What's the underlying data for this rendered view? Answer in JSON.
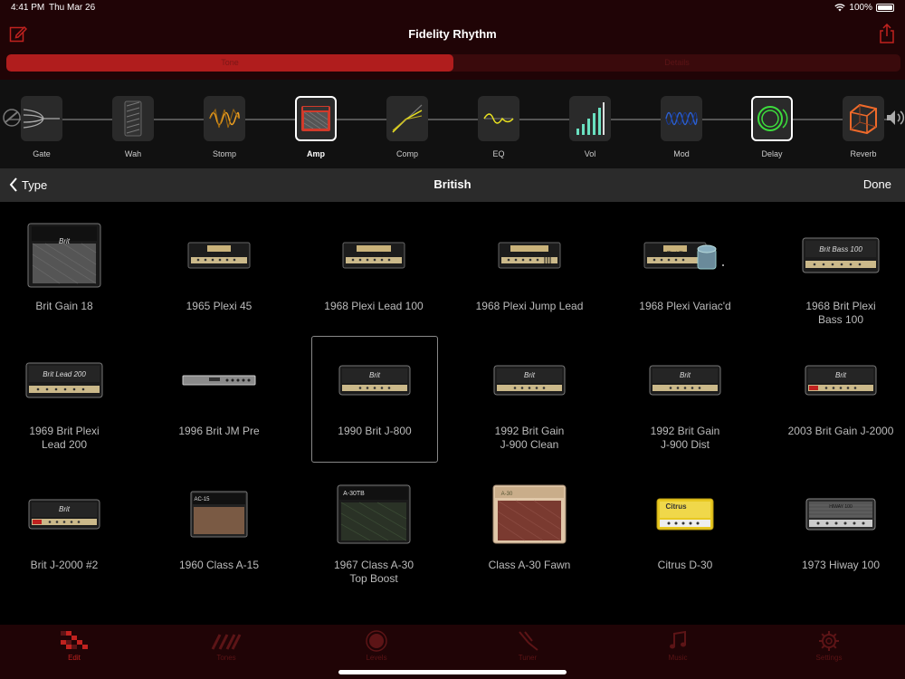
{
  "status": {
    "time": "4:41 PM",
    "date": "Thu Mar 26",
    "battery": "100%"
  },
  "header": {
    "title": "Fidelity Rhythm"
  },
  "segments": [
    {
      "label": "Tone",
      "active": true
    },
    {
      "label": "Details",
      "active": false
    }
  ],
  "chain": {
    "items": [
      {
        "label": "Gate",
        "icon": "gate-icon"
      },
      {
        "label": "Wah",
        "icon": "wah-icon"
      },
      {
        "label": "Stomp",
        "icon": "stomp-icon"
      },
      {
        "label": "Amp",
        "icon": "amp-icon",
        "selected": true
      },
      {
        "label": "Comp",
        "icon": "comp-icon"
      },
      {
        "label": "EQ",
        "icon": "eq-icon"
      },
      {
        "label": "Vol",
        "icon": "vol-icon"
      },
      {
        "label": "Mod",
        "icon": "mod-icon"
      },
      {
        "label": "Delay",
        "icon": "delay-icon"
      },
      {
        "label": "Reverb",
        "icon": "reverb-icon"
      }
    ]
  },
  "typebar": {
    "back_label": "Type",
    "title": "British",
    "done_label": "Done"
  },
  "amps": [
    {
      "name": "Brit Gain 18",
      "plate": "Brit"
    },
    {
      "name": "1965 Plexi 45",
      "plate": "Plexi 45"
    },
    {
      "name": "1968 Plexi Lead 100",
      "plate": "Super Lead 100"
    },
    {
      "name": "1968 Plexi Jump Lead",
      "plate": "Jumped Lead 100"
    },
    {
      "name": "1968 Plexi Variac'd",
      "plate": "Plexi 45"
    },
    {
      "name": "1968 Brit Plexi\nBass 100",
      "plate": "Brit Bass 100"
    },
    {
      "name": "1969 Brit Plexi\nLead 200",
      "plate": "Brit Lead 200"
    },
    {
      "name": "1996 Brit JM Pre",
      "plate": ""
    },
    {
      "name": "1990 Brit J-800",
      "plate": "Brit",
      "selected": true
    },
    {
      "name": "1992 Brit Gain\nJ-900 Clean",
      "plate": "Brit"
    },
    {
      "name": "1992 Brit Gain\nJ-900 Dist",
      "plate": "Brit"
    },
    {
      "name": "2003 Brit Gain J-2000",
      "plate": "Brit"
    },
    {
      "name": "Brit J-2000 #2",
      "plate": "Brit"
    },
    {
      "name": "1960 Class A-15",
      "plate": "AC-15"
    },
    {
      "name": "1967 Class A-30\nTop Boost",
      "plate": "A-30TB"
    },
    {
      "name": "Class A-30 Fawn",
      "plate": "A-30"
    },
    {
      "name": "Citrus D-30",
      "plate": "Citrus"
    },
    {
      "name": "1973 Hiway 100",
      "plate": "HIWAY 100"
    }
  ],
  "tabs": [
    {
      "label": "Edit",
      "icon": "edit-grid-icon",
      "active": true
    },
    {
      "label": "Tones",
      "icon": "tones-icon"
    },
    {
      "label": "Levels",
      "icon": "levels-icon"
    },
    {
      "label": "Tuner",
      "icon": "tuner-icon"
    },
    {
      "label": "Music",
      "icon": "music-icon"
    },
    {
      "label": "Settings",
      "icon": "settings-icon"
    }
  ],
  "colors": {
    "accent": "#b01d1d",
    "nav_bg": "#200406",
    "delay_green": "#3ddc3d",
    "reverb_orange": "#f06a2a"
  }
}
